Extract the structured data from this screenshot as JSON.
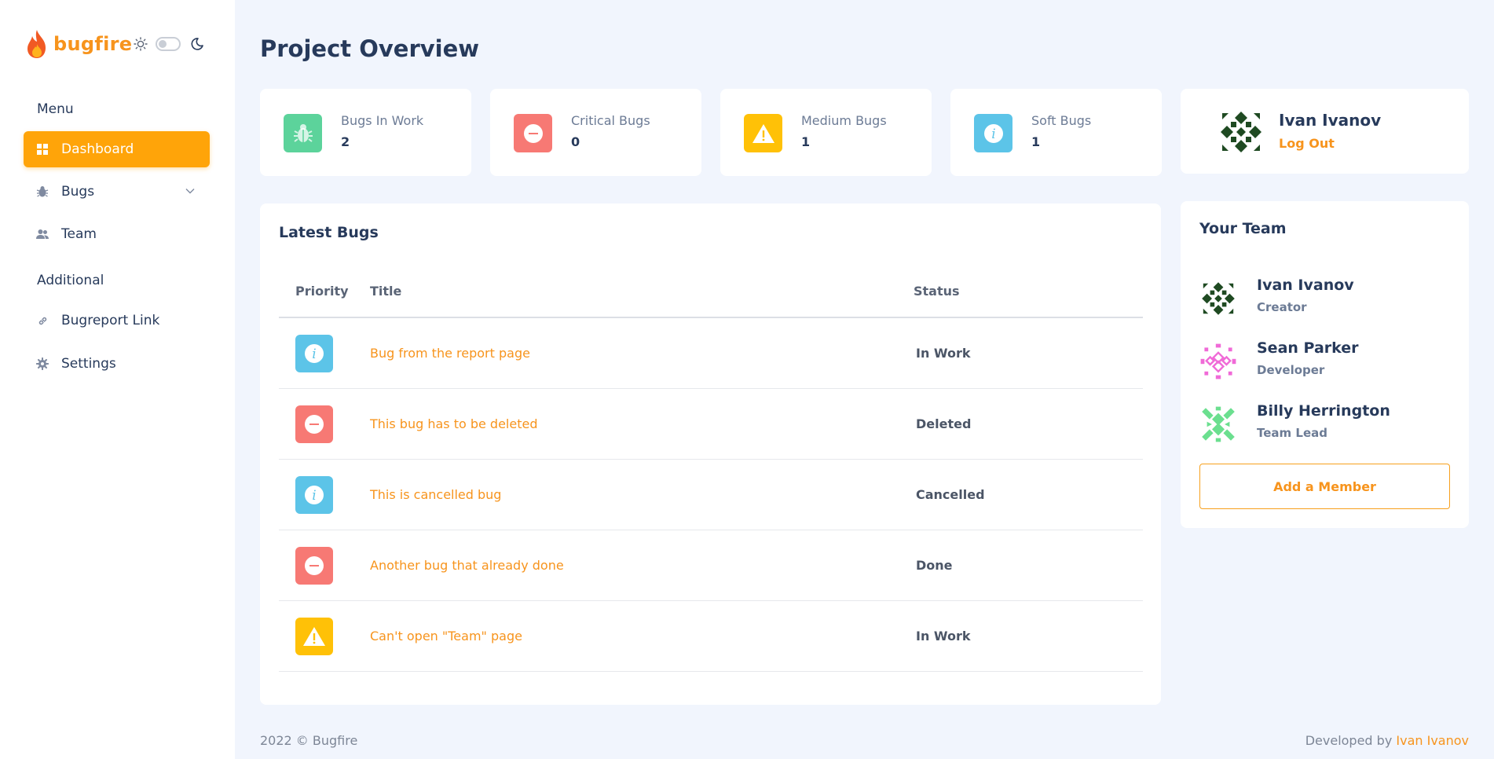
{
  "brand": {
    "name": "bugfire"
  },
  "sidebar": {
    "menu_heading": "Menu",
    "additional_heading": "Additional",
    "items": [
      {
        "label": "Dashboard",
        "icon": "dashboard-icon",
        "active": true
      },
      {
        "label": "Bugs",
        "icon": "bug-icon",
        "expandable": true
      },
      {
        "label": "Team",
        "icon": "users-icon"
      },
      {
        "label": "Bugreport Link",
        "icon": "link-icon"
      },
      {
        "label": "Settings",
        "icon": "gear-icon"
      }
    ]
  },
  "page": {
    "title": "Project Overview"
  },
  "stats": [
    {
      "label": "Bugs In Work",
      "value": "2",
      "icon": "bug-icon",
      "color": "#5cd39b"
    },
    {
      "label": "Critical Bugs",
      "value": "0",
      "icon": "minus-circle-icon",
      "color": "#f77974"
    },
    {
      "label": "Medium Bugs",
      "value": "1",
      "icon": "warning-icon",
      "color": "#ffc107"
    },
    {
      "label": "Soft Bugs",
      "value": "1",
      "icon": "info-icon",
      "color": "#5cc4e8"
    }
  ],
  "profile": {
    "name": "Ivan Ivanov",
    "logout_label": "Log Out"
  },
  "latest_bugs": {
    "title": "Latest Bugs",
    "columns": [
      "Priority",
      "Title",
      "Status"
    ],
    "rows": [
      {
        "priority": "soft",
        "title": "Bug from the report page",
        "status": "In Work"
      },
      {
        "priority": "critical",
        "title": "This bug has to be deleted",
        "status": "Deleted"
      },
      {
        "priority": "soft",
        "title": "This is cancelled bug",
        "status": "Cancelled"
      },
      {
        "priority": "critical",
        "title": "Another bug that already done",
        "status": "Done"
      },
      {
        "priority": "medium",
        "title": "Can't open \"Team\" page",
        "status": "In Work"
      }
    ]
  },
  "team": {
    "title": "Your Team",
    "members": [
      {
        "name": "Ivan Ivanov",
        "role": "Creator"
      },
      {
        "name": "Sean Parker",
        "role": "Developer"
      },
      {
        "name": "Billy Herrington",
        "role": "Team Lead"
      }
    ],
    "add_label": "Add a Member"
  },
  "footer": {
    "copyright": "2022 © Bugfire",
    "developed_by": "Developed by",
    "author": "Ivan Ivanov"
  },
  "colors": {
    "accent": "#ffa409",
    "critical": "#f77974",
    "medium": "#ffc107",
    "soft": "#5cc4e8",
    "in_work": "#5cd39b"
  }
}
